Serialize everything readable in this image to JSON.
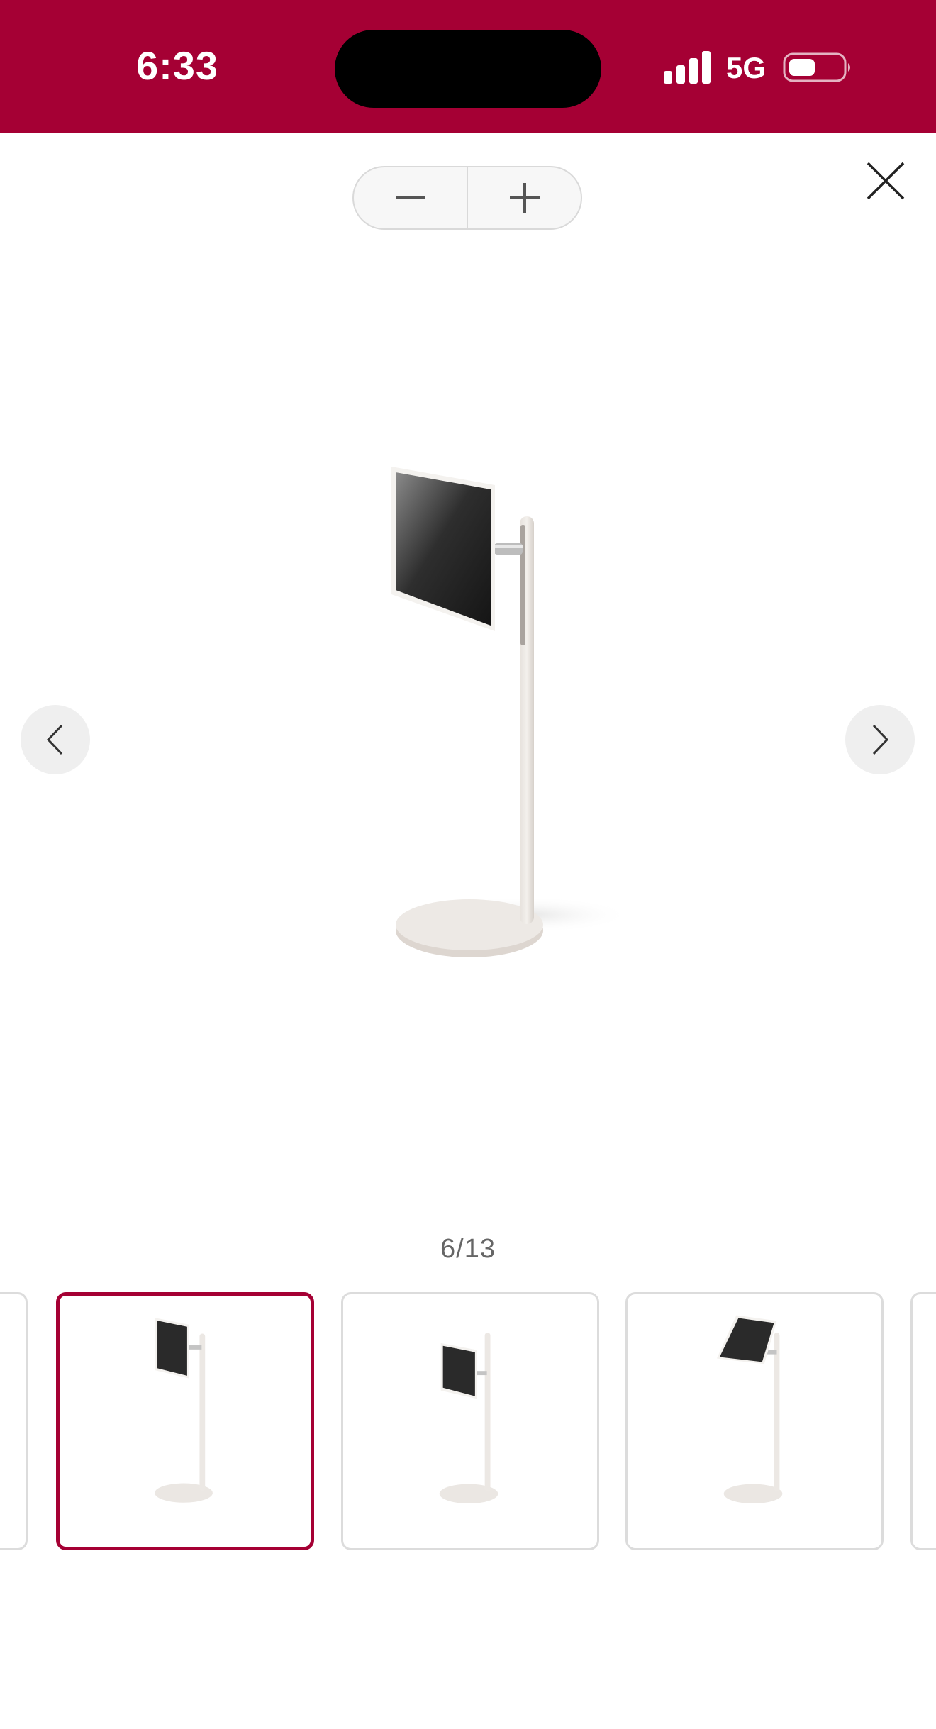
{
  "status_bar": {
    "time": "6:33",
    "network": "5G",
    "background_color": "#a50034",
    "icons": [
      "signal-icon",
      "battery-icon"
    ]
  },
  "viewer": {
    "zoom_out_icon": "minus-icon",
    "zoom_in_icon": "plus-icon",
    "close_icon": "close-icon",
    "prev_icon": "chevron-left-icon",
    "next_icon": "chevron-right-icon",
    "counter": "6/13",
    "accent_color": "#a50034"
  },
  "thumbnails": {
    "selected_index": 1,
    "items": [
      "partial-previous",
      "selected",
      "side-view",
      "tilted-view",
      "partial-next"
    ]
  }
}
